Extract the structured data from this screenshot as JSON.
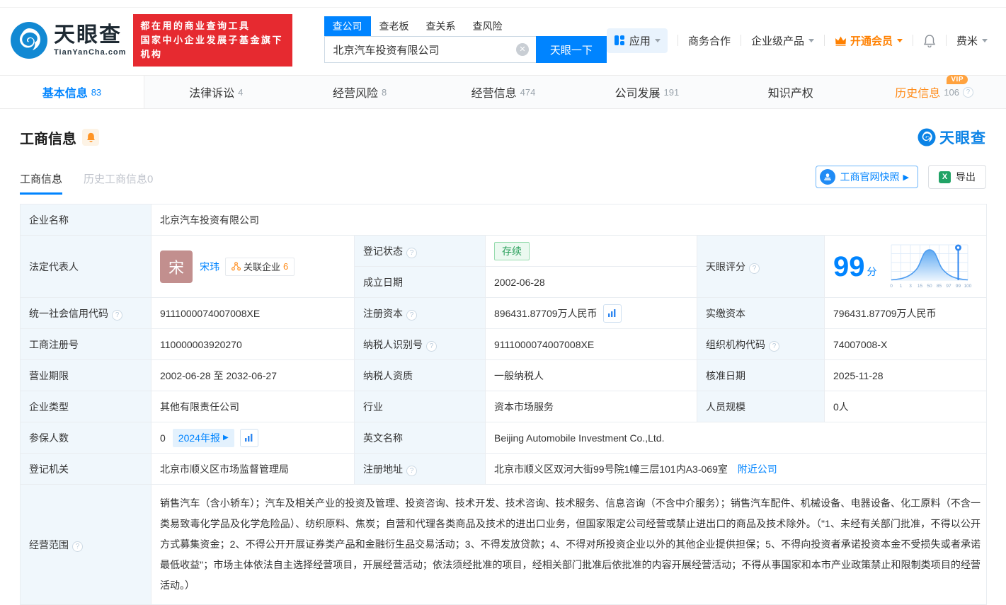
{
  "colors": {
    "brand_blue": "#0084ff",
    "promo_red": "#e62a30",
    "member_orange": "#ff8000",
    "vip_orange": "#ffa23e",
    "status_green": "#2ba05c",
    "history_orange": "#ff8c1a"
  },
  "header": {
    "logo_cn": "天眼查",
    "logo_en": "TianYanCha.com",
    "promo_line1": "都在用的商业查询工具",
    "promo_line2": "国家中小企业发展子基金旗下机构",
    "search_tabs": [
      {
        "label": "查公司",
        "active": true
      },
      {
        "label": "查老板",
        "active": false
      },
      {
        "label": "查关系",
        "active": false
      },
      {
        "label": "查风险",
        "active": false
      }
    ],
    "search_value": "北京汽车投资有限公司",
    "search_button": "天眼一下",
    "nav": {
      "apps": "应用",
      "cooperation": "商务合作",
      "enterprise": "企业级产品",
      "member": "开通会员",
      "user": "费米"
    }
  },
  "tabs": [
    {
      "label": "基本信息",
      "count": "83"
    },
    {
      "label": "法律诉讼",
      "count": "4"
    },
    {
      "label": "经营风险",
      "count": "8"
    },
    {
      "label": "经营信息",
      "count": "474"
    },
    {
      "label": "公司发展",
      "count": "191"
    },
    {
      "label": "知识产权",
      "count": ""
    },
    {
      "label": "历史信息",
      "count": "106",
      "vip": "VIP"
    }
  ],
  "section": {
    "title": "工商信息",
    "watermark": "天眼查",
    "subtab_active": "工商信息",
    "subtab_history": "历史工商信息",
    "subtab_history_count": "0",
    "snapshot_button": "工商官网快照",
    "export_button": "导出"
  },
  "biz": {
    "company_name_label": "企业名称",
    "company_name": "北京汽车投资有限公司",
    "legal_rep_label": "法定代表人",
    "legal_rep_avatar": "宋",
    "legal_rep_name": "宋玮",
    "related_label": "关联企业",
    "related_count": "6",
    "reg_status_label": "登记状态",
    "reg_status": "存续",
    "est_date_label": "成立日期",
    "est_date": "2002-06-28",
    "score_label": "天眼评分",
    "score": "99",
    "score_unit": "分",
    "credit_code_label": "统一社会信用代码",
    "credit_code": "9111000074007008XE",
    "reg_capital_label": "注册资本",
    "reg_capital": "896431.87709万人民币",
    "paid_capital_label": "实缴资本",
    "paid_capital": "796431.87709万人民币",
    "reg_no_label": "工商注册号",
    "reg_no": "110000003920270",
    "tax_id_label": "纳税人识别号",
    "tax_id": "9111000074007008XE",
    "org_code_label": "组织机构代码",
    "org_code": "74007008-X",
    "term_label": "营业期限",
    "term": "2002-06-28 至 2032-06-27",
    "tax_type_label": "纳税人资质",
    "tax_type": "一般纳税人",
    "approve_date_label": "核准日期",
    "approve_date": "2025-11-28",
    "company_type_label": "企业类型",
    "company_type": "其他有限责任公司",
    "industry_label": "行业",
    "industry": "资本市场服务",
    "staff_label": "人员规模",
    "staff": "0人",
    "insured_label": "参保人数",
    "insured": "0",
    "annual_report": "2024年报",
    "en_name_label": "英文名称",
    "en_name": "Beijing Automobile Investment Co.,Ltd.",
    "authority_label": "登记机关",
    "authority": "北京市顺义区市场监督管理局",
    "address_label": "注册地址",
    "address": "北京市顺义区双河大街99号院1幢三层101内A3-069室",
    "nearby_link": "附近公司",
    "scope_label": "经营范围",
    "scope": "销售汽车（含小轿车）；汽车及相关产业的投资及管理、投资咨询、技术开发、技术咨询、技术服务、信息咨询（不含中介服务）；销售汽车配件、机械设备、电器设备、化工原料（不含一类易致毒化学品及化学危险品）、纺织原料、焦炭；自营和代理各类商品及技术的进出口业务，但国家限定公司经营或禁止进出口的商品及技术除外。（\"1、未经有关部门批准，不得以公开方式募集资金；2、不得公开开展证券类产品和金融衍生品交易活动；3、不得发放贷款；4、不得对所投资企业以外的其他企业提供担保；5、不得向投资者承诺投资本金不受损失或者承诺最低收益\"；市场主体依法自主选择经营项目，开展经营活动；依法须经批准的项目，经相关部门批准后依批准的内容开展经营活动；不得从事国家和本市产业政策禁止和限制类项目的经营活动。）"
  },
  "score_chart": {
    "type": "area",
    "x_labels": [
      "0",
      "1",
      "3",
      "15",
      "50",
      "85",
      "97",
      "99",
      "100"
    ],
    "marker_value": "99"
  }
}
